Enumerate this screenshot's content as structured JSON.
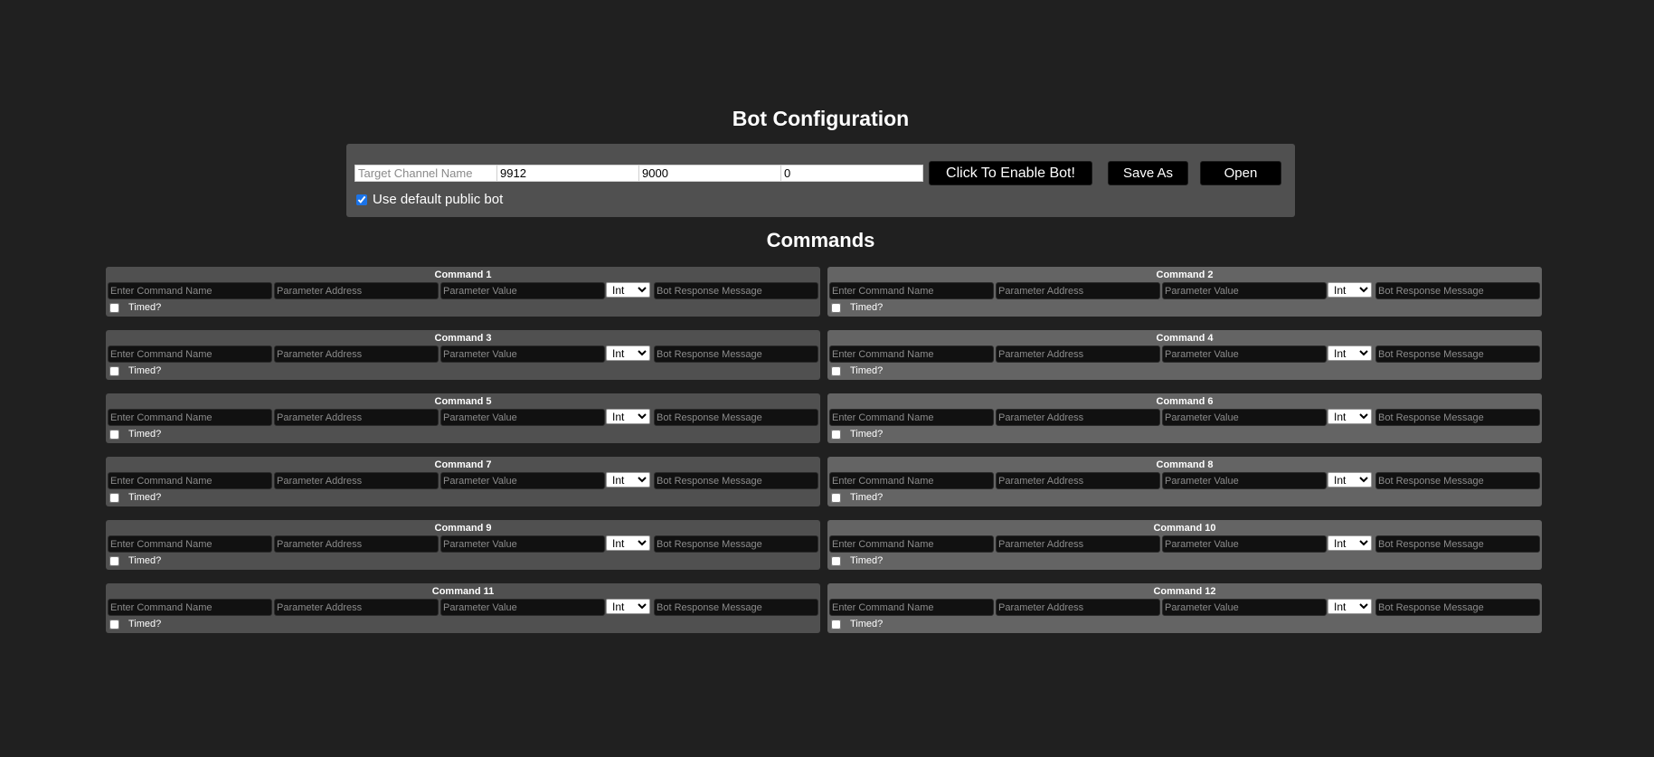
{
  "header": {
    "title": "Bot Configuration",
    "commands_title": "Commands"
  },
  "config": {
    "channel_placeholder": "Target Channel Name",
    "field_2_value": "9912",
    "field_3_value": "9000",
    "field_4_value": "0",
    "enable_label": "Click To Enable Bot!",
    "save_label": "Save As",
    "open_label": "Open",
    "default_bot_label": "Use default public bot",
    "default_bot_checked": true
  },
  "command_form": {
    "name_placeholder": "Enter Command Name",
    "address_placeholder": "Parameter Address",
    "value_placeholder": "Parameter Value",
    "type_selected": "Int",
    "response_placeholder": "Bot Response Message",
    "timed_label": "Timed?"
  },
  "commands": [
    {
      "title": "Command 1"
    },
    {
      "title": "Command 2"
    },
    {
      "title": "Command 3"
    },
    {
      "title": "Command 4"
    },
    {
      "title": "Command 5"
    },
    {
      "title": "Command 6"
    },
    {
      "title": "Command 7"
    },
    {
      "title": "Command 8"
    },
    {
      "title": "Command 9"
    },
    {
      "title": "Command 10"
    },
    {
      "title": "Command 11"
    },
    {
      "title": "Command 12"
    }
  ],
  "colors": {
    "background": "#202020",
    "panel": "#505050",
    "panel_alt": "#646464",
    "button": "#000000",
    "field": "#111111"
  }
}
